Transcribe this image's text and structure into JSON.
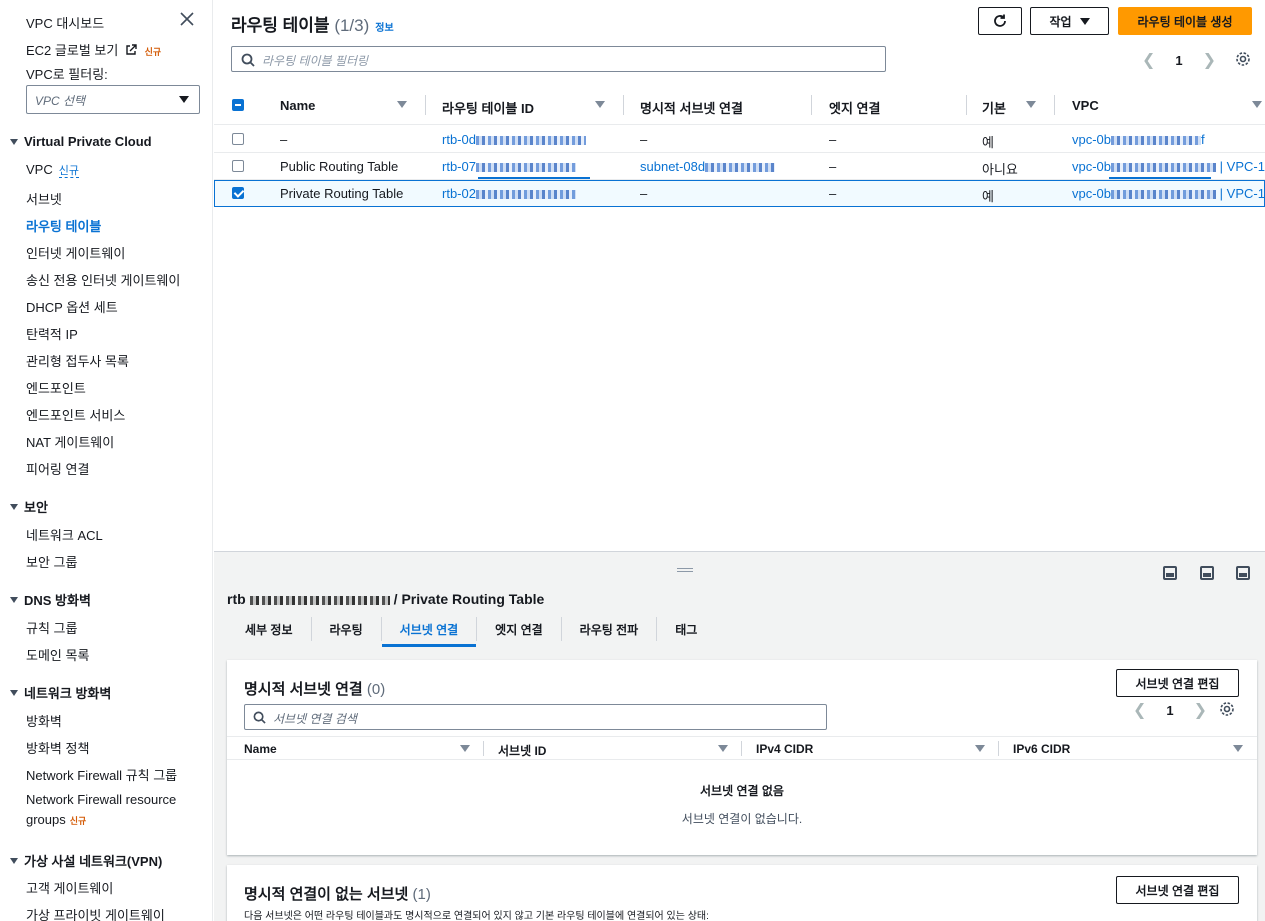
{
  "sidebar": {
    "top_links": [
      {
        "label": "VPC 대시보드"
      },
      {
        "label": "EC2 글로벌 보기",
        "badge": "신규"
      }
    ],
    "filter_label": "VPC로 필터링:",
    "vpc_select_placeholder": "VPC 선택",
    "sections": [
      {
        "title": "Virtual Private Cloud",
        "items": [
          "VPC",
          "서브넷",
          "라우팅 테이블",
          "인터넷 게이트웨이",
          "송신 전용 인터넷 게이트웨이",
          "DHCP 옵션 세트",
          "탄력적 IP",
          "관리형 접두사 목록",
          "엔드포인트",
          "엔드포인트 서비스",
          "NAT 게이트웨이",
          "피어링 연결"
        ],
        "vpc_badge": "신규"
      },
      {
        "title": "보안",
        "items": [
          "네트워크 ACL",
          "보안 그룹"
        ]
      },
      {
        "title": "DNS 방화벽",
        "items": [
          "규칙 그룹",
          "도메인 목록"
        ]
      },
      {
        "title": "네트워크 방화벽",
        "items": [
          "방화벽",
          "방화벽 정책",
          "Network Firewall 규칙 그룹",
          "Network Firewall resource",
          "groups"
        ],
        "groups_badge": "신규"
      },
      {
        "title": "가상 사설 네트워크(VPN)",
        "items": [
          "고객 게이트웨이",
          "가상 프라이빗 게이트웨이"
        ]
      }
    ]
  },
  "header": {
    "title": "라우팅 테이블",
    "count": "(1/3)",
    "info": "정보",
    "actions_label": "작업",
    "create_label": "라우팅 테이블 생성",
    "filter_placeholder": "라우팅 테이블 필터링",
    "page": "1"
  },
  "table": {
    "columns": [
      "Name",
      "라우팅 테이블 ID",
      "명시적 서브넷 연결",
      "엣지 연결",
      "기본",
      "VPC"
    ],
    "rows": [
      {
        "name": "–",
        "id": "rtb-0d",
        "subnet": "–",
        "edge": "–",
        "main": "예",
        "vpc": "vpc-0b",
        "vpc_suffix": "f",
        "selected": false
      },
      {
        "name": "Public Routing Table",
        "id": "rtb-07",
        "subnet": "subnet-08d",
        "edge": "–",
        "main": "아니요",
        "vpc": "vpc-0b",
        "vpc_suffix": "| VPC-1",
        "selected": false
      },
      {
        "name": "Private Routing Table",
        "id": "rtb-02",
        "subnet": "–",
        "edge": "–",
        "main": "예",
        "vpc": "vpc-0b",
        "vpc_suffix": "| VPC-1",
        "selected": true
      }
    ]
  },
  "detail": {
    "title_prefix": "rtb",
    "title_suffix": "/ Private Routing Table",
    "tabs": [
      "세부 정보",
      "라우팅",
      "서브넷 연결",
      "엣지 연결",
      "라우팅 전파",
      "태그"
    ],
    "active_tab": "서브넷 연결",
    "explicit": {
      "title": "명시적 서브넷 연결",
      "count": "(0)",
      "edit_label": "서브넷 연결 편집",
      "search_placeholder": "서브넷 연결 검색",
      "page": "1",
      "columns": [
        "Name",
        "서브넷 ID",
        "IPv4 CIDR",
        "IPv6 CIDR"
      ],
      "empty_title": "서브넷 연결 없음",
      "empty_desc": "서브넷 연결이 없습니다."
    },
    "implicit": {
      "title": "명시적 연결이 없는 서브넷",
      "count": "(1)",
      "edit_label": "서브넷 연결 편집",
      "desc": "다음 서브넷은 어떤 라우팅 테이블과도 명시적으로 연결되어 있지 않고 기본 라우팅 테이블에 연결되어 있는 상태:"
    }
  }
}
